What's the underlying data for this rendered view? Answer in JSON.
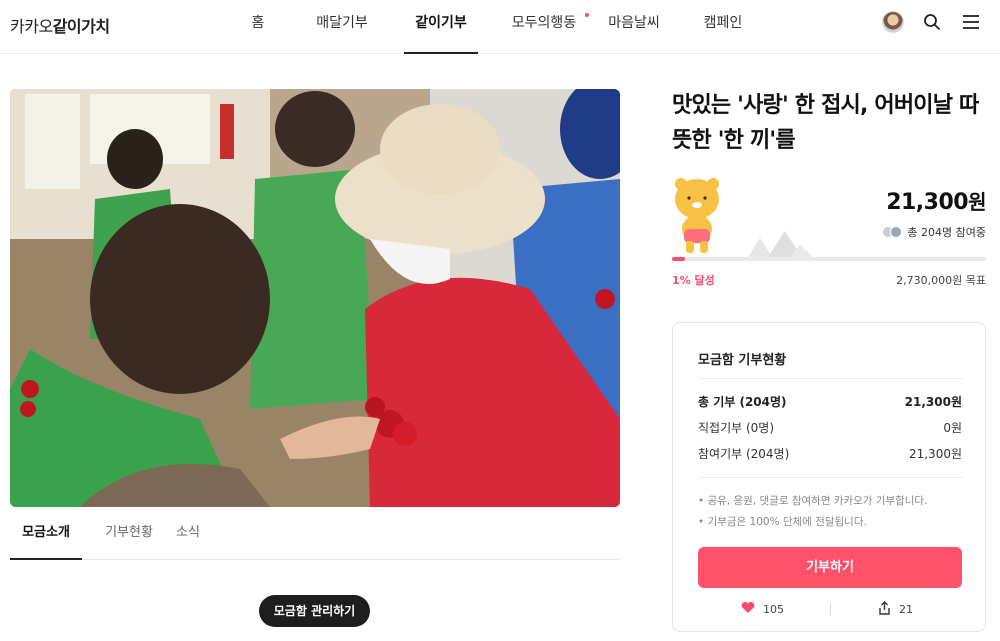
{
  "header": {
    "logo_prefix": "카카오",
    "logo_bold": "같이가치",
    "nav": [
      {
        "label": "홈",
        "active": false,
        "dot": false
      },
      {
        "label": "매달기부",
        "active": false,
        "dot": false
      },
      {
        "label": "같이기부",
        "active": true,
        "dot": false
      },
      {
        "label": "모두의행동",
        "active": false,
        "dot": true
      },
      {
        "label": "마음날씨",
        "active": false,
        "dot": false
      },
      {
        "label": "캠페인",
        "active": false,
        "dot": false
      }
    ],
    "icons": [
      "profile-avatar",
      "search-icon",
      "menu-icon"
    ]
  },
  "campaign": {
    "title": "맛있는 '사랑' 한 접시, 어버이날 따뜻한 '한 끼'를",
    "amount": "21,300",
    "amount_unit": "원",
    "participants": "총 204명 참여중",
    "progress_percent": 1,
    "percent_label": "1% 달성",
    "goal_label": "2,730,000원 목표",
    "accent_color": "#ff4b6e"
  },
  "tabs": [
    {
      "label": "모금소개",
      "active": true
    },
    {
      "label": "기부현황",
      "active": false
    },
    {
      "label": "소식",
      "active": false
    }
  ],
  "manage_button": "모금함 관리하기",
  "status_box": {
    "title": "모금함 기부현황",
    "rows": [
      {
        "label": "총 기부 (204명)",
        "value": "21,300원",
        "bold": true
      },
      {
        "label": "직접기부 (0명)",
        "value": "0원",
        "bold": false
      },
      {
        "label": "참여기부 (204명)",
        "value": "21,300원",
        "bold": false
      }
    ],
    "notes": [
      "• 공유, 응원, 댓글로 참여하면 카카오가 기부합니다.",
      "• 기부금은 100% 단체에 전달됩니다."
    ],
    "donate_button": "기부하기",
    "likes": "105",
    "shares": "21"
  }
}
